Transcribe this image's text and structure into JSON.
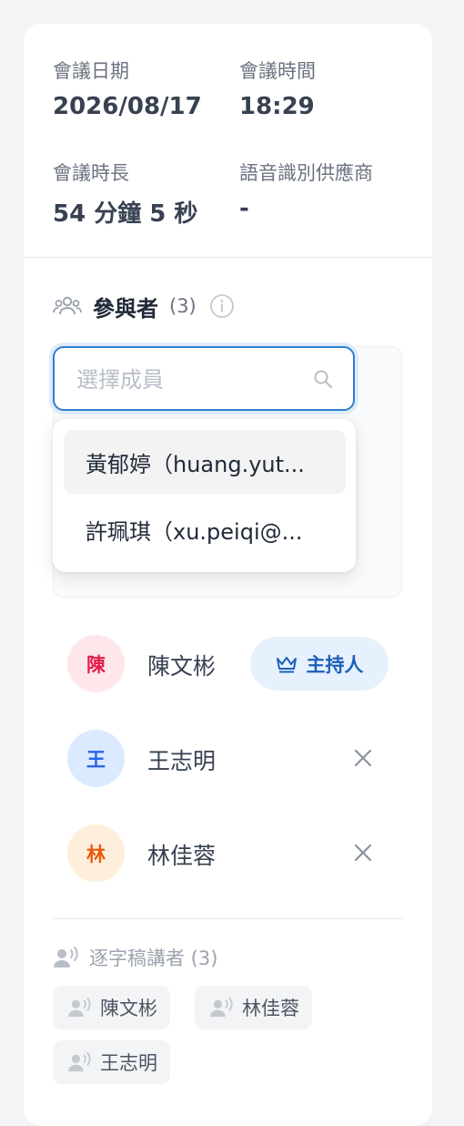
{
  "meeting": {
    "date_label": "會議日期",
    "date_value": "2026/08/17",
    "time_label": "會議時間",
    "time_value": "18:29",
    "duration_label": "會議時長",
    "duration_value": "54 分鐘 5 秒",
    "provider_label": "語音識別供應商",
    "provider_value": "-"
  },
  "participants": {
    "title": "參與者",
    "count": "(3)",
    "search": {
      "placeholder": "選擇成員",
      "value": ""
    },
    "dropdown": [
      {
        "label": "黃郁婷（huang.yut..."
      },
      {
        "label": "許珮琪（xu.peiqi@..."
      }
    ],
    "list": [
      {
        "initial": "陳",
        "name": "陳文彬",
        "role": "主持人",
        "avatar_bg": "#fde7ea",
        "avatar_fg": "#e11d48"
      },
      {
        "initial": "王",
        "name": "王志明",
        "avatar_bg": "#dbeafe",
        "avatar_fg": "#2563eb"
      },
      {
        "initial": "林",
        "name": "林佳蓉",
        "avatar_bg": "#feefdc",
        "avatar_fg": "#ea580c"
      }
    ]
  },
  "speakers": {
    "title": "逐字稿講者 (3)",
    "chips": [
      {
        "label": "陳文彬"
      },
      {
        "label": "林佳蓉"
      },
      {
        "label": "王志明"
      }
    ]
  },
  "colors": {
    "accent": "#2f7fd0",
    "host_badge_bg": "#e6f1fd",
    "host_badge_fg": "#1d5fb8"
  }
}
